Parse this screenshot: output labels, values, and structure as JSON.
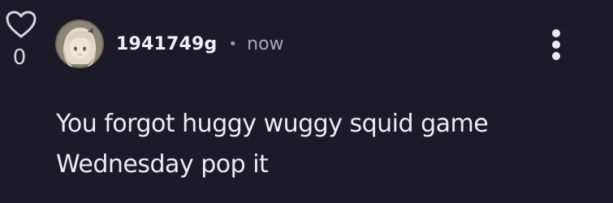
{
  "comment": {
    "likes": "0",
    "username": "1941749g",
    "separator": "•",
    "timestamp": "now",
    "text": "You forgot huggy wuggy squid game Wednesday pop it"
  },
  "icons": {
    "like": "heart-outline-icon",
    "more": "more-vertical-icon"
  },
  "colors": {
    "background": "#1c1a28",
    "text": "#ececf0",
    "muted": "#a9a8b4"
  }
}
